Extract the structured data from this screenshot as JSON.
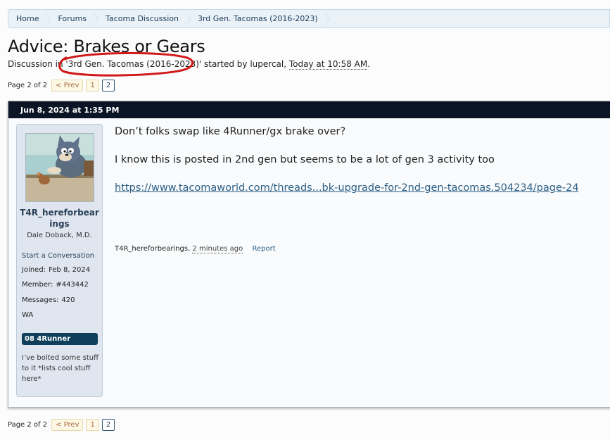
{
  "breadcrumb": [
    "Home",
    "Forums",
    "Tacoma Discussion",
    "3rd Gen. Tacomas (2016-2023)"
  ],
  "thread": {
    "title": "Advice: Brakes or Gears",
    "meta_prefix": "Discussion in ",
    "meta_forum": "'3rd Gen. Tacomas (2016-2023)'",
    "meta_mid": " started by ",
    "meta_author": "lupercal",
    "meta_comma": ", ",
    "meta_time": "Today at 10:58 AM",
    "meta_end": "."
  },
  "pagination": {
    "label": "Page 2 of 2",
    "prev": "< Prev",
    "pages": [
      "1",
      "2"
    ],
    "current": "2"
  },
  "post": {
    "date": "Jun 8, 2024 at 1:35 PM",
    "user": {
      "name": "T4R_hereforbearings",
      "name_wrapped": "T4R_hereforbear\nings",
      "title": "Dale Doback, M.D.",
      "start_conversation": "Start a Conversation",
      "joined_label": "Joined:",
      "joined": "Feb 8, 2024",
      "member_label": "Member:",
      "member": "#443442",
      "messages_label": "Messages:",
      "messages": "420",
      "location": "WA",
      "vehicle": "08 4Runner",
      "note": "I’ve bolted some stuff to it *lists cool stuff here*"
    },
    "body": [
      "Don’t folks swap like 4Runner/gx brake over?",
      "I know this is posted in 2nd gen but seems to be a lot of gen 3 activity too"
    ],
    "link": "https://www.tacomaworld.com/threads...bk-upgrade-for-2nd-gen-tacomas.504234/page-24",
    "footer_author": "T4R_hereforbearings",
    "footer_time": "2 minutes ago",
    "report": "Report"
  },
  "colors": {
    "header_bg": "#0b1526",
    "breadcrumb_bg": "#eaf2f8",
    "vehicle_badge": "#0f3f5a",
    "annotation": "#d01818"
  }
}
